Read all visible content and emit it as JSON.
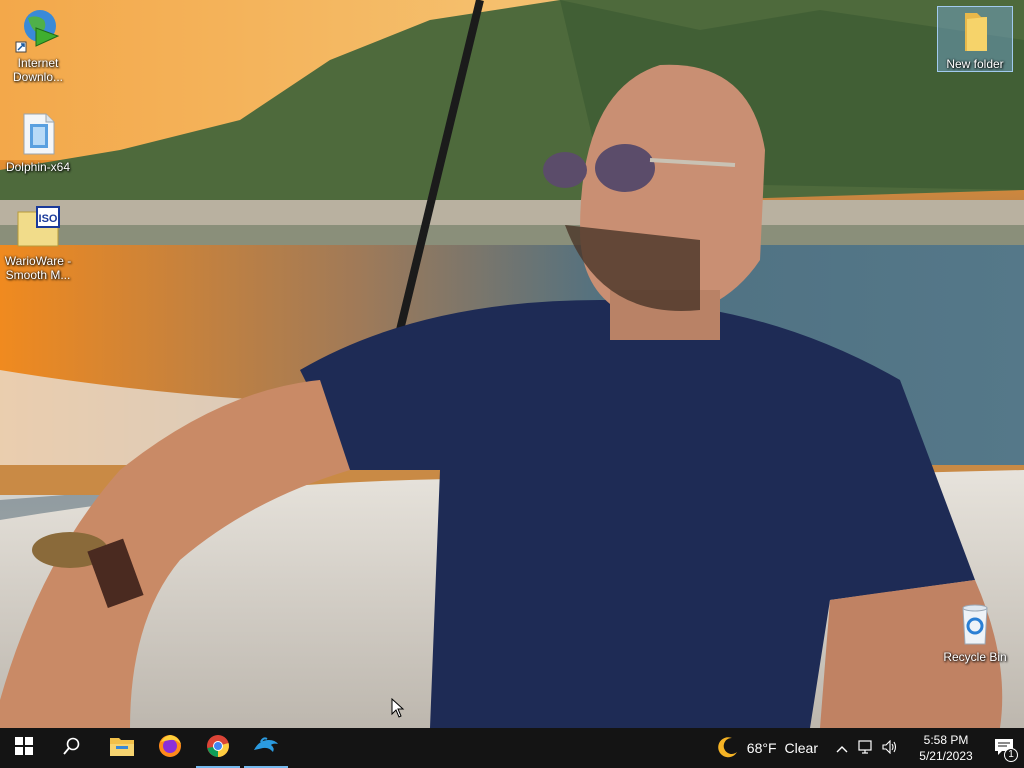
{
  "desktop": {
    "icons": [
      {
        "label": "Internet Downlo...",
        "icon": "idm-globe-icon"
      },
      {
        "label": "Dolphin-x64",
        "icon": "dolphin-file-icon"
      },
      {
        "label": "WarioWare - Smooth M...",
        "icon": "iso-file-icon"
      },
      {
        "label": "New folder",
        "icon": "folder-icon"
      },
      {
        "label": "Recycle Bin",
        "icon": "recycle-bin-icon"
      }
    ]
  },
  "taskbar": {
    "pinned": [
      "start-icon",
      "search-icon",
      "file-explorer-icon",
      "firefox-icon",
      "chrome-icon",
      "dolphin-icon"
    ],
    "weather": {
      "temp": "68°F",
      "condition": "Clear",
      "icon": "moon-icon"
    },
    "clock": {
      "time": "5:58 PM",
      "date": "5/21/2023"
    },
    "notifications": {
      "count": "1"
    }
  }
}
